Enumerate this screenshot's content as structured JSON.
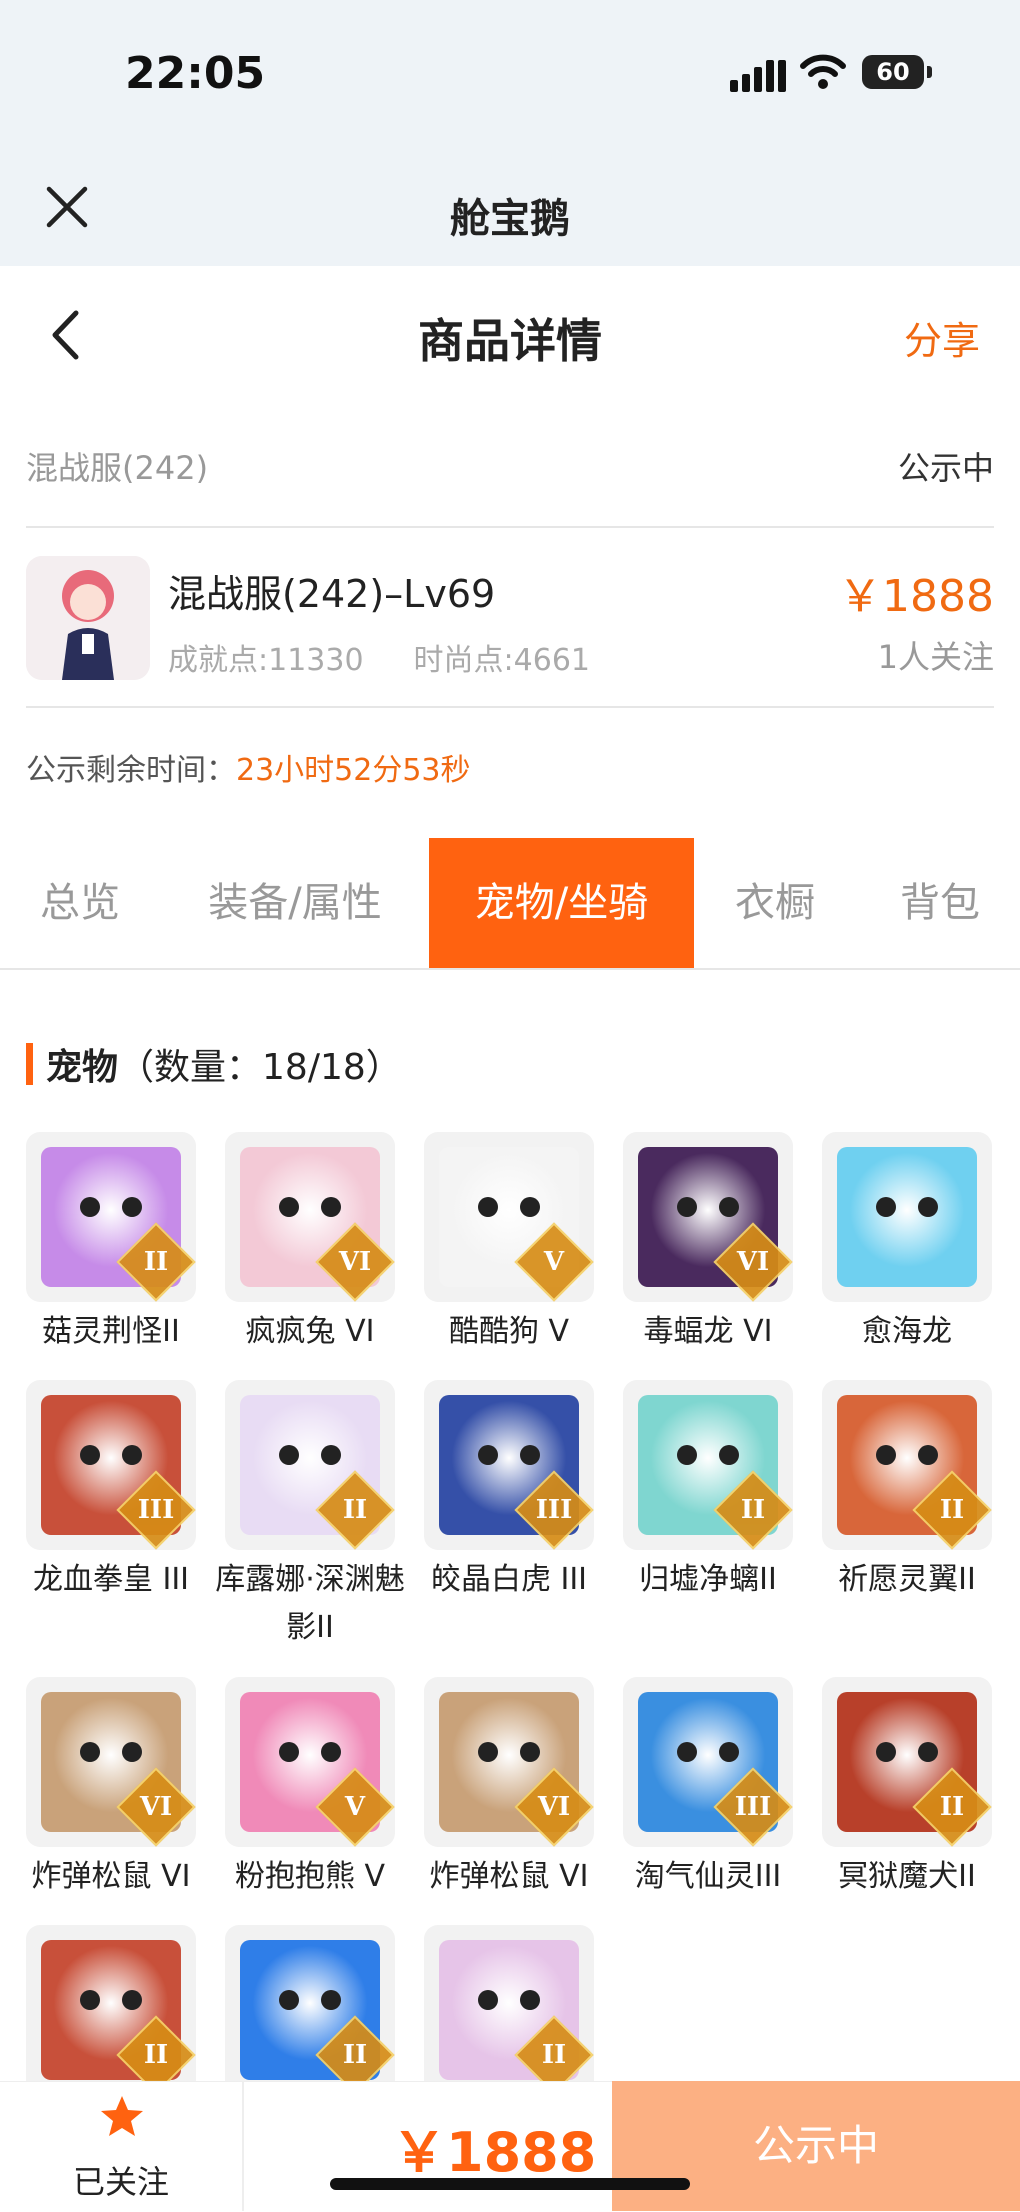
{
  "status": {
    "time": "22:05",
    "battery": "60"
  },
  "mini_program": {
    "title": "舱宝鹅"
  },
  "header": {
    "title": "商品详情",
    "share": "分享"
  },
  "server": {
    "name": "混战服(242)",
    "state": "公示中"
  },
  "product": {
    "name": "混战服(242)–Lv69",
    "achievement": "成就点:11330",
    "fashion": "时尚点:4661",
    "price": "￥1888",
    "followers": "1人关注"
  },
  "remain": {
    "label": "公示剩余时间：",
    "value": "23小时52分53秒"
  },
  "tabs": [
    "总览",
    "装备/属性",
    "宠物/坐骑",
    "衣橱",
    "背包"
  ],
  "active_tab": "宠物/坐骑",
  "section": {
    "title": "宠物",
    "count": "（数量：18/18）"
  },
  "pets": [
    {
      "name": "菇灵荆怪II",
      "rank": "II",
      "color": "#c68be8"
    },
    {
      "name": "疯疯兔 VI",
      "rank": "VI",
      "color": "#f3c9d6"
    },
    {
      "name": "酷酷狗 V",
      "rank": "V",
      "color": "#f4f4f4"
    },
    {
      "name": "毒蝠龙 VI",
      "rank": "VI",
      "color": "#4a2a5e"
    },
    {
      "name": "愈海龙",
      "rank": "",
      "color": "#6fd0f0"
    },
    {
      "name": "龙血拳皇 III",
      "rank": "III",
      "color": "#c8503a"
    },
    {
      "name": "库露娜·深渊魅影II",
      "rank": "II",
      "color": "#e8dcf4"
    },
    {
      "name": "皎晶白虎 III",
      "rank": "III",
      "color": "#3550a8"
    },
    {
      "name": "归墟净螭II",
      "rank": "II",
      "color": "#7fd6d0"
    },
    {
      "name": "祈愿灵翼II",
      "rank": "II",
      "color": "#d8663a"
    },
    {
      "name": "炸弹松鼠 VI",
      "rank": "VI",
      "color": "#c9a27a"
    },
    {
      "name": "粉抱抱熊 V",
      "rank": "V",
      "color": "#f08ab8"
    },
    {
      "name": "炸弹松鼠 VI",
      "rank": "VI",
      "color": "#c9a27a"
    },
    {
      "name": "淘气仙灵III",
      "rank": "III",
      "color": "#3a8fe0"
    },
    {
      "name": "冥狱魔犬II",
      "rank": "II",
      "color": "#b8402a"
    },
    {
      "name": "",
      "rank": "II",
      "color": "#c8503a"
    },
    {
      "name": "",
      "rank": "II",
      "color": "#2f7ee8"
    },
    {
      "name": "",
      "rank": "II",
      "color": "#e6c4e8"
    }
  ],
  "bottom": {
    "follow_label": "已关注",
    "price": "￥1888",
    "action": "公示中"
  },
  "colors": {
    "accent": "#ff6210",
    "action_bg": "#fcb083"
  }
}
